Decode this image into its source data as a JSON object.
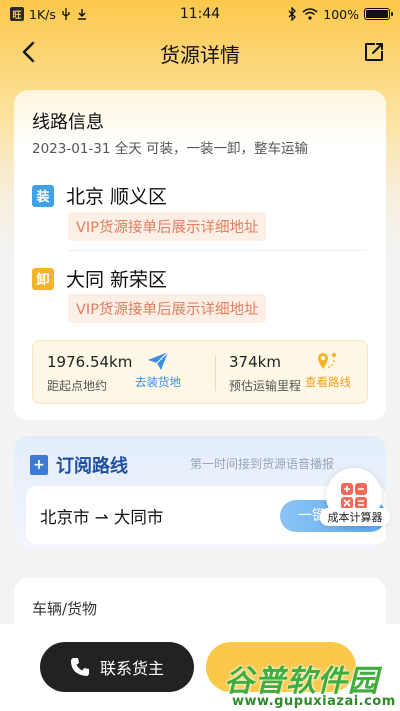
{
  "status_bar": {
    "speed": "1K/s",
    "time": "11:44",
    "battery_text": "100%",
    "battery_level": 1.0
  },
  "nav": {
    "title": "货源详情"
  },
  "route_info": {
    "title": "线路信息",
    "subtitle": "2023-01-31 全天 可装，一装一卸，整车运输",
    "load": {
      "tag": "装",
      "city": "北京 顺义区",
      "note": "VIP货源接单后展示详细地址"
    },
    "unload": {
      "tag": "卸",
      "city": "大同 新荣区",
      "note": "VIP货源接单后展示详细地址"
    },
    "distance_to_start": {
      "value": "1976.54km",
      "label": "距起点地约",
      "action": "去装货地"
    },
    "estimated_mileage": {
      "value": "374km",
      "label": "预估运输里程",
      "action": "查看路线"
    }
  },
  "subscribe": {
    "title": "订阅路线",
    "hint": "第一时间接到货源语音播报",
    "route": "北京市 ⇀ 大同市",
    "button": "一键订"
  },
  "calculator": {
    "label": "成本计算器"
  },
  "vehicle": {
    "title": "车辆/货物"
  },
  "bottom": {
    "contact_label": "联系货主"
  },
  "watermark": {
    "text": "谷普软件园",
    "url": "www.gupuxiazai.com"
  },
  "colors": {
    "accent": "#fbc84a",
    "load_tag": "#3fa2e6",
    "unload_tag": "#f0b52a",
    "vip_text": "#e07f5f",
    "link_blue": "#3c8ee0",
    "link_orange": "#f0a020"
  }
}
